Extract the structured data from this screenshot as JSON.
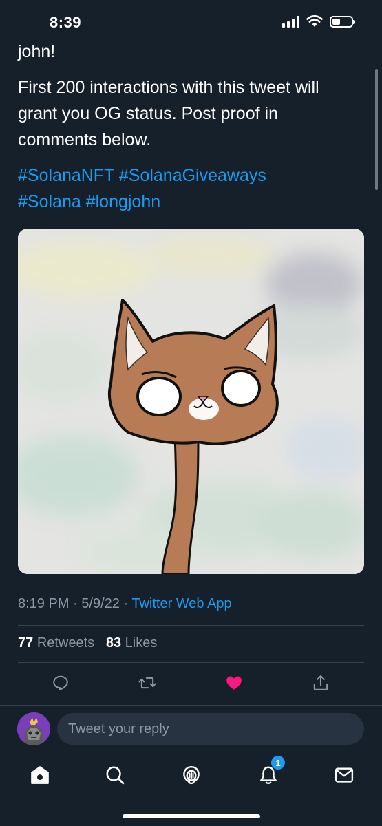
{
  "status_bar": {
    "time": "8:39"
  },
  "tweet": {
    "text_line1": "john!",
    "text_line2": "First 200 interactions with this tweet will grant you OG status. Post proof in comments below.",
    "hashtags": [
      "#SolanaNFT",
      "#SolanaGiveaways",
      "#Solana",
      "#longjohn"
    ],
    "time": "8:19 PM",
    "date": "5/9/22",
    "separator": "·",
    "source": "Twitter Web App"
  },
  "stats": {
    "retweets_count": "77",
    "retweets_label": "Retweets",
    "likes_count": "83",
    "likes_label": "Likes"
  },
  "actions": {
    "reply_icon": "reply-icon",
    "retweet_icon": "retweet-icon",
    "like_icon": "heart-filled-icon",
    "share_icon": "share-icon",
    "liked": true,
    "like_color": "#f91880"
  },
  "reply": {
    "placeholder": "Tweet your reply"
  },
  "tabbar": {
    "tabs": [
      "home-icon",
      "search-icon",
      "spaces-icon",
      "notifications-icon",
      "messages-icon"
    ],
    "notifications_badge": "1"
  },
  "colors": {
    "background": "#15202b",
    "accent": "#1d9bf0",
    "muted": "#8b98a5",
    "divider": "#38444d"
  }
}
